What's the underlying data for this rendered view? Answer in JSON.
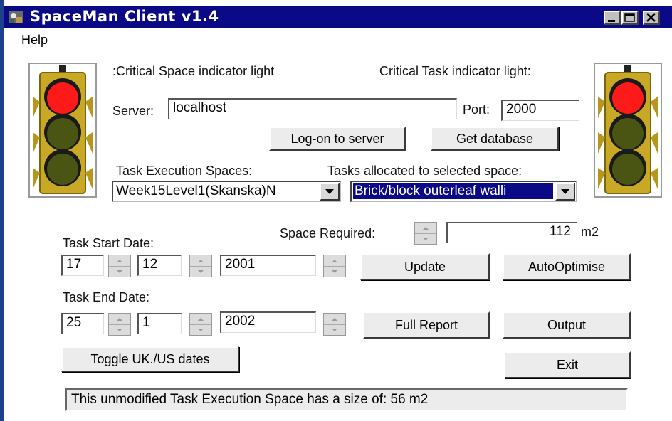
{
  "window": {
    "title": "SpaceMan Client v1.4"
  },
  "menu": {
    "items": [
      {
        "label": "Help"
      }
    ]
  },
  "indicators": {
    "critical_space_label": ":Critical Space indicator light",
    "critical_task_label": "Critical Task indicator light:"
  },
  "connection": {
    "server_label": "Server:",
    "server_value": "localhost",
    "port_label": "Port:",
    "port_value": "2000",
    "logon_label": "Log-on to server",
    "get_db_label": "Get database"
  },
  "spaces": {
    "label": "Task Execution Spaces:",
    "selected": "Week15Level1(Skanska)N"
  },
  "tasks": {
    "label": "Tasks allocated to selected space:",
    "selected": "Brick/block outerleaf walli"
  },
  "space_required": {
    "label": "Space Required:",
    "value": "112",
    "unit": "m2"
  },
  "start_date": {
    "label": "Task Start Date:",
    "day": "17",
    "month": "12",
    "year": "2001"
  },
  "end_date": {
    "label": "Task End Date:",
    "day": "25",
    "month": "1",
    "year": "2002"
  },
  "buttons": {
    "update": "Update",
    "auto_optimise": "AutoOptimise",
    "full_report": "Full Report",
    "output": "Output",
    "toggle_dates": "Toggle UK./US dates",
    "exit": "Exit"
  },
  "status": {
    "text": "This unmodified Task Execution Space has a size of: 56 m2"
  },
  "colors": {
    "title_bar": "#0a0a86",
    "light_red": "#ff1a1a",
    "light_off": "#4a5514",
    "light_housing": "#c9a826"
  }
}
